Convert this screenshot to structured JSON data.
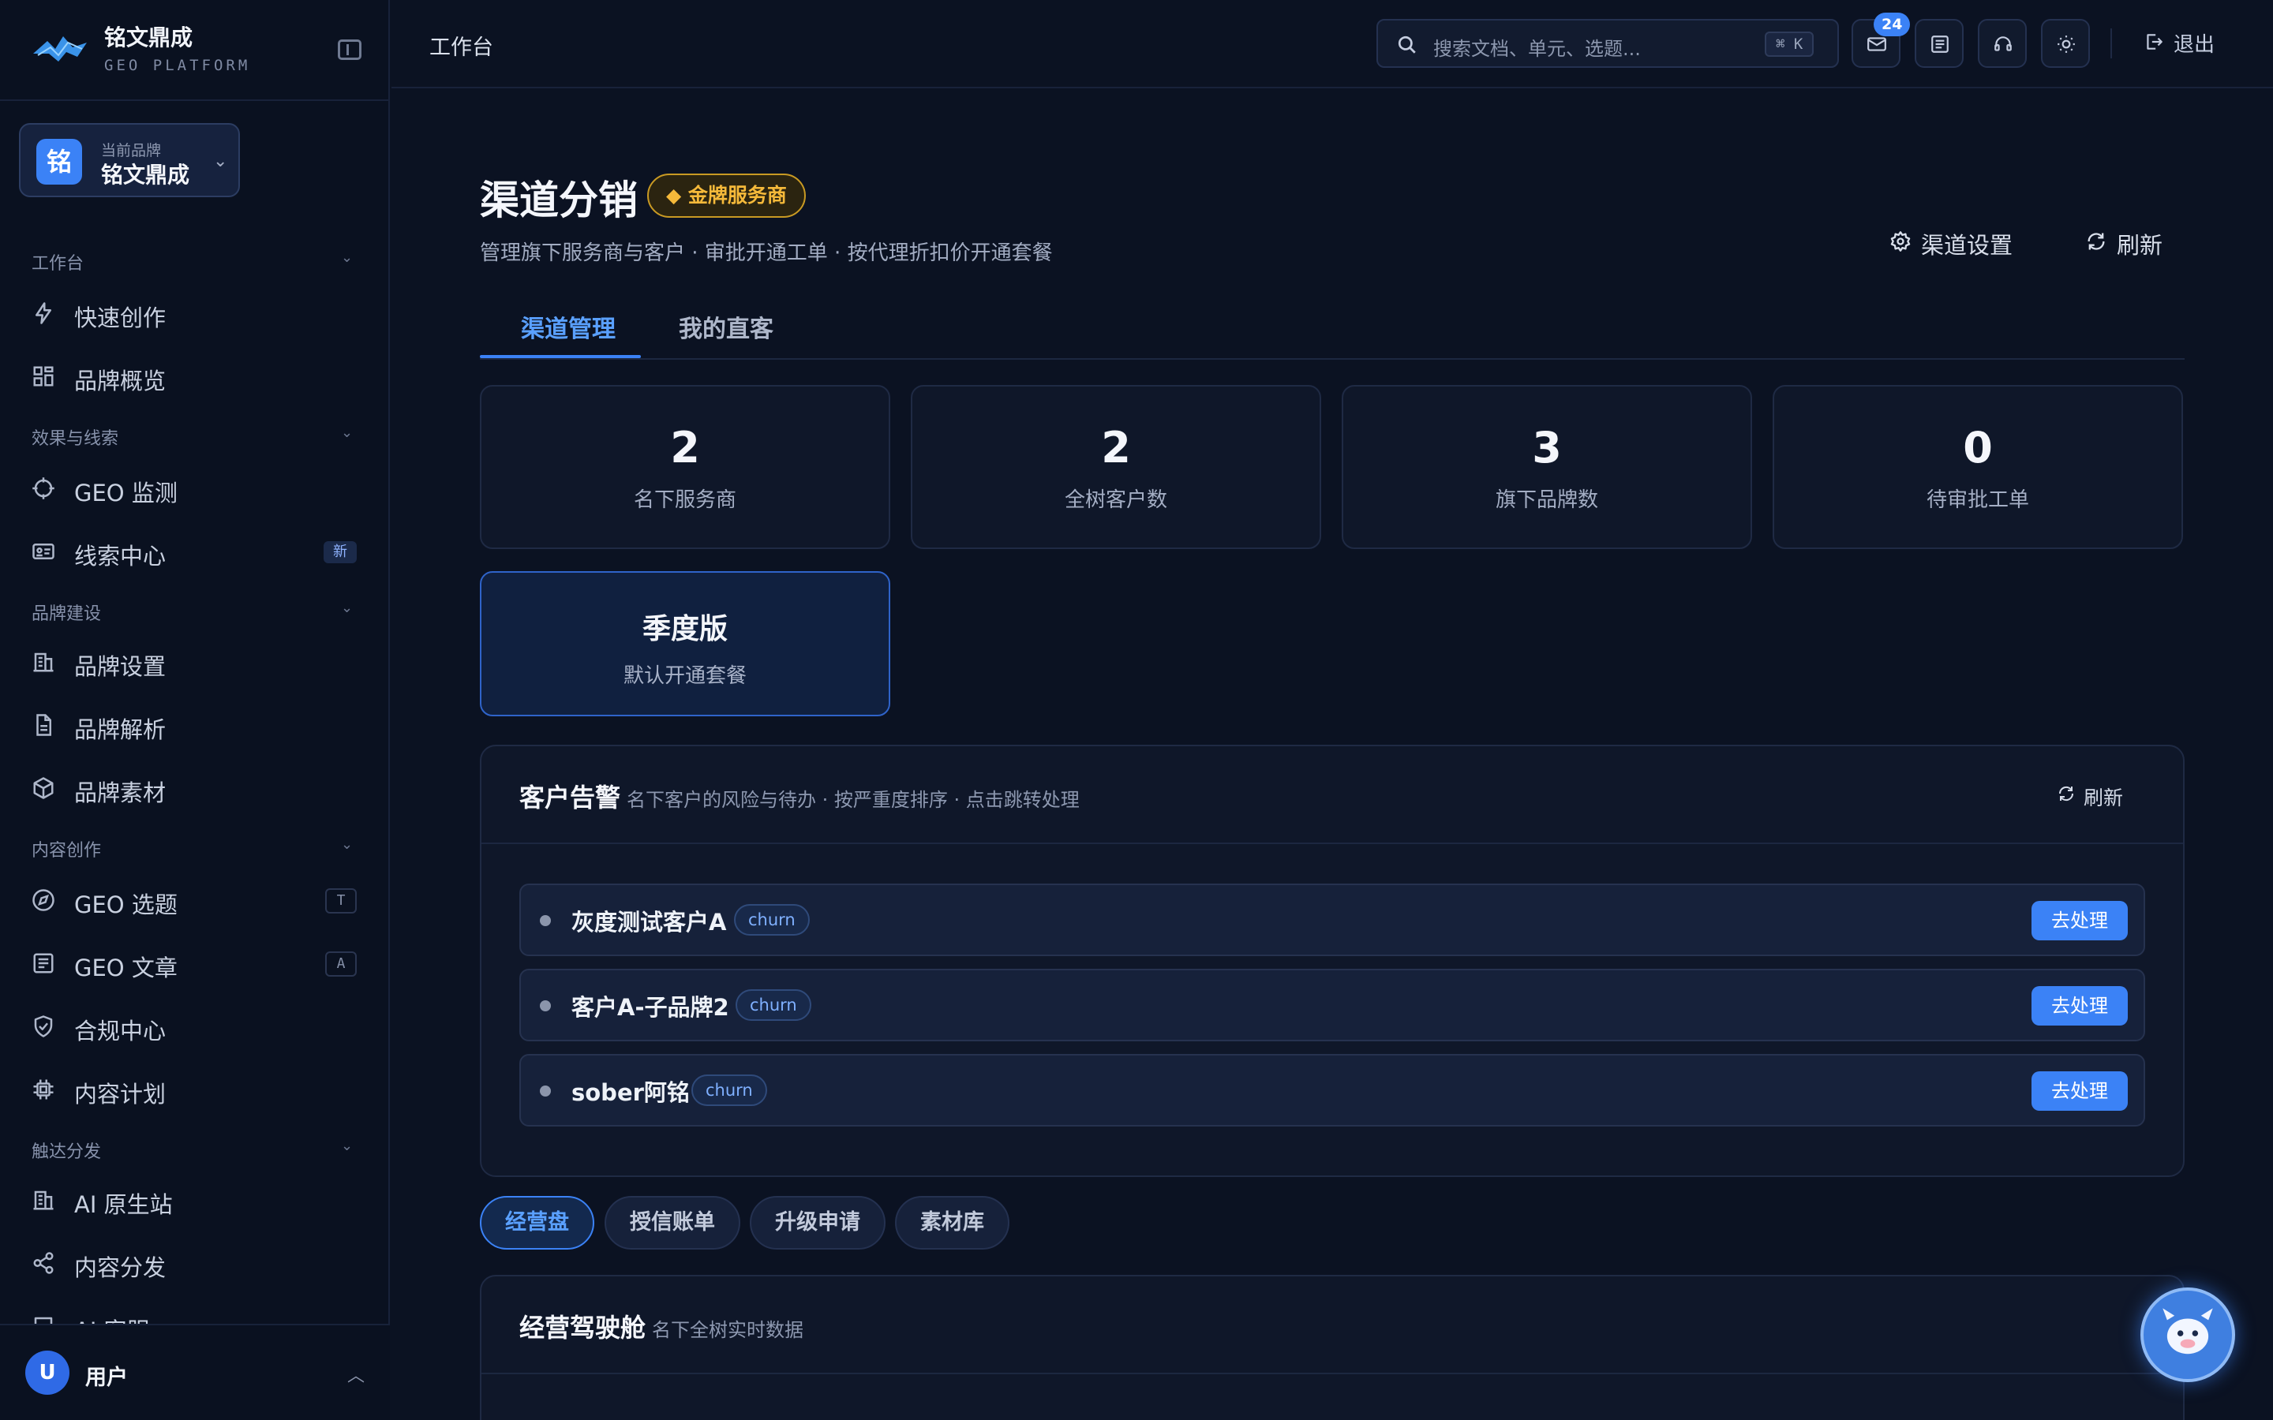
{
  "app": {
    "name": "铭文鼎成",
    "subtitle": "GEO PLATFORM"
  },
  "brand_switcher": {
    "avatar": "铭",
    "label": "当前品牌",
    "value": "铭文鼎成"
  },
  "sidebar": {
    "groups": [
      {
        "label": "工作台",
        "items": [
          {
            "label": "快速创作",
            "icon": "lightning-icon"
          },
          {
            "label": "品牌概览",
            "icon": "grid-icon"
          }
        ]
      },
      {
        "label": "效果与线索",
        "items": [
          {
            "label": "GEO 监测",
            "icon": "crosshair-icon"
          },
          {
            "label": "线索中心",
            "icon": "id-card-icon",
            "badge": "新"
          }
        ]
      },
      {
        "label": "品牌建设",
        "items": [
          {
            "label": "品牌设置",
            "icon": "building-icon"
          },
          {
            "label": "品牌解析",
            "icon": "document-icon"
          },
          {
            "label": "品牌素材",
            "icon": "cube-icon"
          }
        ]
      },
      {
        "label": "内容创作",
        "items": [
          {
            "label": "GEO 选题",
            "icon": "compass-icon",
            "shortcut": "T"
          },
          {
            "label": "GEO 文章",
            "icon": "article-icon",
            "shortcut": "A"
          },
          {
            "label": "合规中心",
            "icon": "shield-icon"
          },
          {
            "label": "内容计划",
            "icon": "chip-icon"
          }
        ]
      },
      {
        "label": "触达分发",
        "items": [
          {
            "label": "AI 原生站",
            "icon": "building-icon"
          },
          {
            "label": "内容分发",
            "icon": "share-icon"
          },
          {
            "label": "AI 客服",
            "icon": "chat-icon"
          }
        ]
      }
    ],
    "user": {
      "avatar": "U",
      "name": "用户"
    }
  },
  "topbar": {
    "breadcrumb": "工作台",
    "search_placeholder": "搜索文档、单元、选题...",
    "search_shortcut": "⌘ K",
    "notification_count": "24",
    "logout_label": "退出"
  },
  "page": {
    "title": "渠道分销",
    "tier_badge": "◆ 金牌服务商",
    "description": "管理旗下服务商与客户 · 审批开通工单 · 按代理折扣价开通套餐",
    "actions": {
      "settings": "渠道设置",
      "refresh": "刷新"
    },
    "tabs": [
      {
        "label": "渠道管理",
        "active": true
      },
      {
        "label": "我的直客",
        "active": false
      }
    ],
    "stats": [
      {
        "value": "2",
        "label": "名下服务商"
      },
      {
        "value": "2",
        "label": "全树客户数"
      },
      {
        "value": "3",
        "label": "旗下品牌数"
      },
      {
        "value": "0",
        "label": "待审批工单"
      }
    ],
    "package": {
      "value": "季度版",
      "label": "默认开通套餐"
    },
    "alerts": {
      "title": "客户告警",
      "description": "名下客户的风险与待办 · 按严重度排序 · 点击跳转处理",
      "refresh_label": "刷新",
      "items": [
        {
          "name": "灰度测试客户A",
          "tag": "churn",
          "action": "去处理"
        },
        {
          "name": "客户A-子品牌2",
          "tag": "churn",
          "action": "去处理"
        },
        {
          "name": "sober阿铭",
          "tag": "churn",
          "action": "去处理"
        }
      ]
    },
    "sub_tabs": [
      {
        "label": "经营盘",
        "active": true
      },
      {
        "label": "授信账单",
        "active": false
      },
      {
        "label": "升级申请",
        "active": false
      },
      {
        "label": "素材库",
        "active": false
      }
    ],
    "cockpit": {
      "title": "经营驾驶舱",
      "description": "名下全树实时数据"
    }
  },
  "colors": {
    "background": "#0b1222",
    "accent": "#3b82f6",
    "gold": "#f5b93a"
  }
}
